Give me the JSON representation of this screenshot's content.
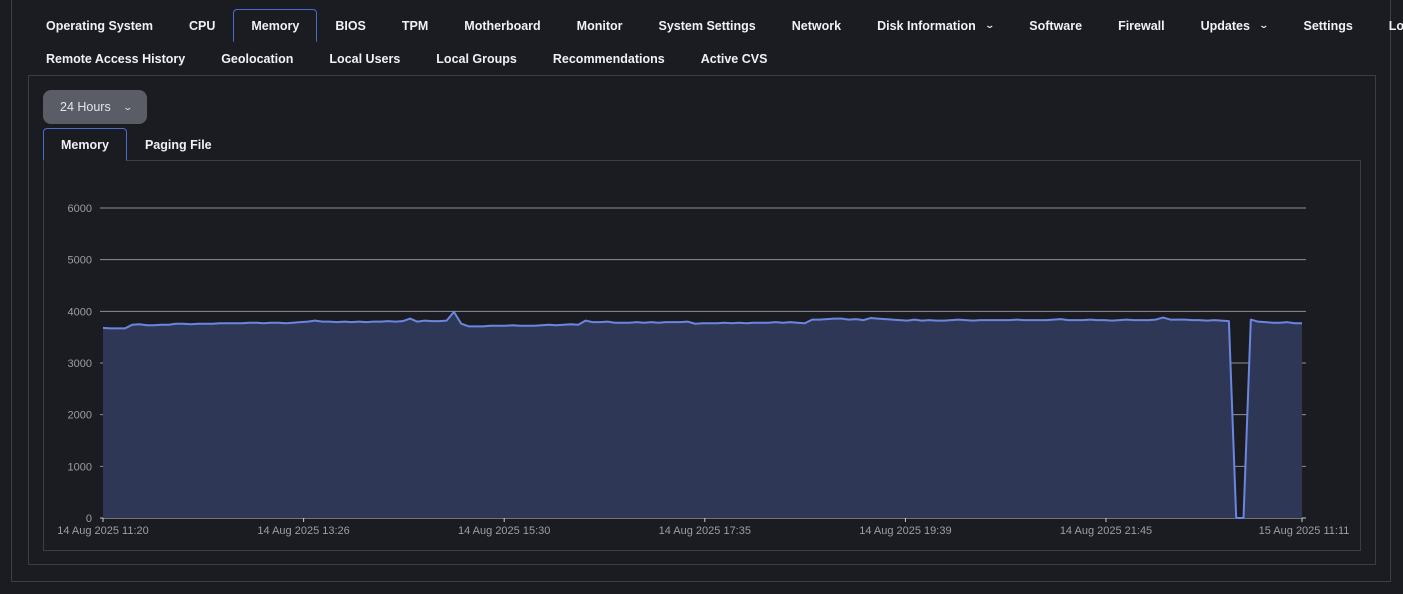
{
  "tabs_row1": [
    {
      "label": "Operating System",
      "name": "tab-operating-system"
    },
    {
      "label": "CPU",
      "name": "tab-cpu"
    },
    {
      "label": "Memory",
      "name": "tab-memory",
      "active": true
    },
    {
      "label": "BIOS",
      "name": "tab-bios"
    },
    {
      "label": "TPM",
      "name": "tab-tpm"
    },
    {
      "label": "Motherboard",
      "name": "tab-motherboard"
    },
    {
      "label": "Monitor",
      "name": "tab-monitor"
    },
    {
      "label": "System Settings",
      "name": "tab-system-settings"
    },
    {
      "label": "Network",
      "name": "tab-network"
    },
    {
      "label": "Disk Information",
      "name": "tab-disk-information",
      "dropdown": true
    },
    {
      "label": "Software",
      "name": "tab-software"
    },
    {
      "label": "Firewall",
      "name": "tab-firewall"
    },
    {
      "label": "Updates",
      "name": "tab-updates",
      "dropdown": true
    },
    {
      "label": "Settings",
      "name": "tab-settings"
    },
    {
      "label": "Location",
      "name": "tab-location"
    }
  ],
  "tabs_row2": [
    {
      "label": "Remote Access History",
      "name": "tab-remote-access-history"
    },
    {
      "label": "Geolocation",
      "name": "tab-geolocation"
    },
    {
      "label": "Local Users",
      "name": "tab-local-users"
    },
    {
      "label": "Local Groups",
      "name": "tab-local-groups"
    },
    {
      "label": "Recommendations",
      "name": "tab-recommendations"
    },
    {
      "label": "Active CVS",
      "name": "tab-active-cvs"
    }
  ],
  "range_select": {
    "value": "24 Hours"
  },
  "subtabs": [
    {
      "label": "Memory",
      "name": "subtab-memory",
      "active": true
    },
    {
      "label": "Paging File",
      "name": "subtab-paging-file"
    }
  ],
  "chart_data": {
    "type": "area",
    "title": "",
    "xlabel": "",
    "ylabel": "",
    "ylim": [
      0,
      6000
    ],
    "yticks": [
      0,
      1000,
      2000,
      3000,
      4000,
      5000,
      6000
    ],
    "xtick_labels": [
      "14 Aug 2025 11:20",
      "14 Aug 2025 13:26",
      "14 Aug 2025 15:30",
      "14 Aug 2025 17:35",
      "14 Aug 2025 19:39",
      "14 Aug 2025 21:45",
      "15 Aug 2025 11:11"
    ],
    "grid": true,
    "line_color": "#6b86e0",
    "fill_color": "#2f3756",
    "series": [
      {
        "values": [
          3680,
          3670,
          3670,
          3670,
          3740,
          3750,
          3730,
          3730,
          3740,
          3740,
          3760,
          3760,
          3750,
          3760,
          3760,
          3760,
          3770,
          3770,
          3770,
          3770,
          3780,
          3780,
          3770,
          3780,
          3780,
          3770,
          3780,
          3790,
          3800,
          3820,
          3800,
          3800,
          3790,
          3800,
          3790,
          3800,
          3790,
          3800,
          3800,
          3810,
          3800,
          3810,
          3860,
          3800,
          3820,
          3810,
          3810,
          3820,
          3990,
          3760,
          3710,
          3710,
          3710,
          3720,
          3720,
          3720,
          3730,
          3720,
          3720,
          3720,
          3730,
          3740,
          3730,
          3740,
          3750,
          3740,
          3820,
          3790,
          3790,
          3800,
          3780,
          3780,
          3780,
          3790,
          3780,
          3790,
          3780,
          3790,
          3790,
          3790,
          3800,
          3760,
          3770,
          3770,
          3770,
          3780,
          3770,
          3780,
          3770,
          3780,
          3780,
          3780,
          3790,
          3780,
          3790,
          3780,
          3770,
          3840,
          3840,
          3850,
          3860,
          3860,
          3840,
          3850,
          3830,
          3870,
          3860,
          3850,
          3840,
          3830,
          3820,
          3840,
          3820,
          3830,
          3820,
          3820,
          3830,
          3840,
          3830,
          3820,
          3830,
          3830,
          3830,
          3830,
          3830,
          3840,
          3830,
          3830,
          3830,
          3830,
          3840,
          3850,
          3830,
          3830,
          3830,
          3840,
          3830,
          3830,
          3820,
          3830,
          3840,
          3830,
          3830,
          3830,
          3840,
          3880,
          3840,
          3840,
          3840,
          3830,
          3830,
          3820,
          3830,
          3820,
          3810,
          0,
          0,
          3840,
          3800,
          3790,
          3780,
          3780,
          3790,
          3770,
          3770
        ]
      }
    ]
  }
}
